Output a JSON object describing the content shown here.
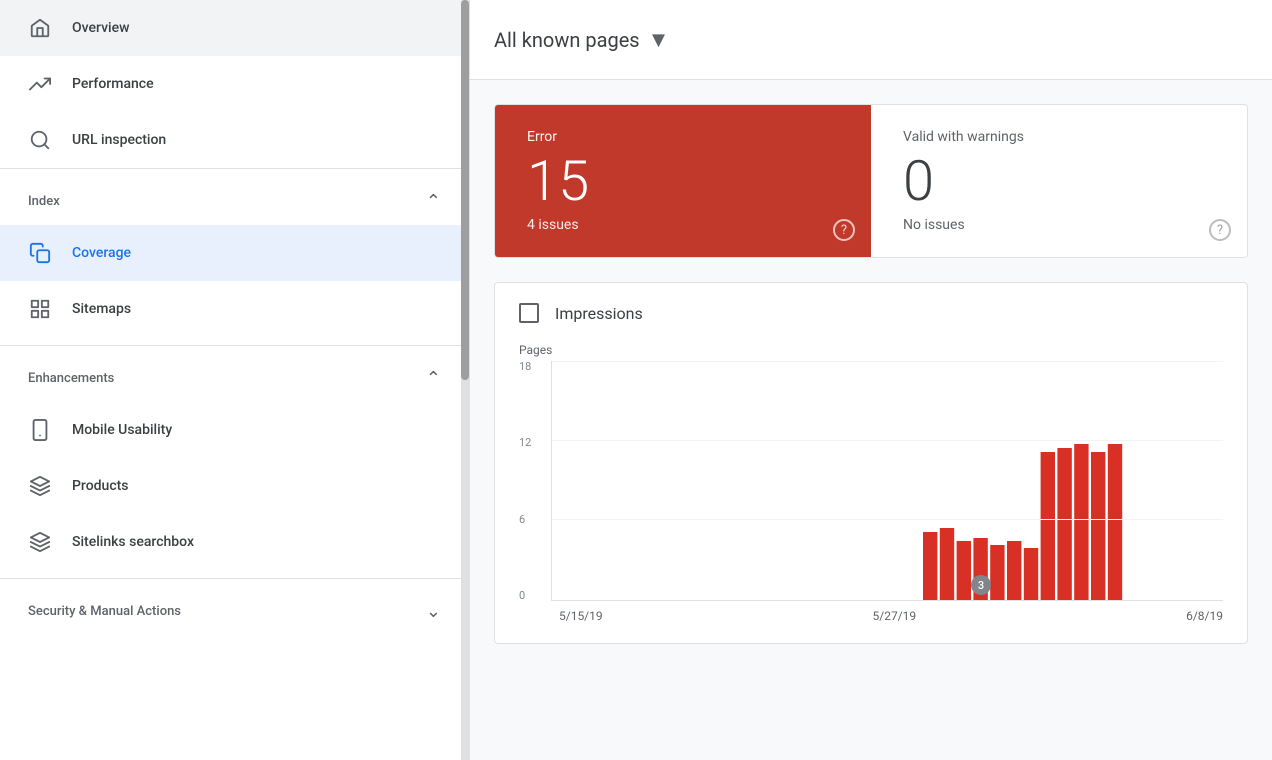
{
  "sidebar": {
    "items_top": [
      {
        "id": "overview",
        "label": "Overview",
        "icon": "home"
      },
      {
        "id": "performance",
        "label": "Performance",
        "icon": "trending-up"
      },
      {
        "id": "url-inspection",
        "label": "URL inspection",
        "icon": "search"
      }
    ],
    "sections": [
      {
        "id": "index",
        "label": "Index",
        "expanded": true,
        "items": [
          {
            "id": "coverage",
            "label": "Coverage",
            "icon": "copy",
            "active": true
          },
          {
            "id": "sitemaps",
            "label": "Sitemaps",
            "icon": "grid"
          }
        ]
      },
      {
        "id": "enhancements",
        "label": "Enhancements",
        "expanded": true,
        "items": [
          {
            "id": "mobile-usability",
            "label": "Mobile Usability",
            "icon": "mobile"
          },
          {
            "id": "products",
            "label": "Products",
            "icon": "layers"
          },
          {
            "id": "sitelinks-searchbox",
            "label": "Sitelinks searchbox",
            "icon": "layers2"
          }
        ]
      },
      {
        "id": "security",
        "label": "Security & Manual Actions",
        "expanded": false,
        "items": []
      }
    ]
  },
  "header": {
    "page_selector_label": "All known pages",
    "dropdown_aria": "Change page filter"
  },
  "error_card": {
    "label": "Error",
    "number": "15",
    "sub": "4 issues",
    "help": "?"
  },
  "valid_card": {
    "label": "Valid with warnings",
    "number": "0",
    "sub": "No issues",
    "help": "?"
  },
  "impressions": {
    "label": "Impressions",
    "y_axis_label": "Pages",
    "y_values": [
      "18",
      "12",
      "6",
      "0"
    ],
    "x_labels": [
      "5/15/19",
      "5/27/19",
      "6/8/19"
    ],
    "tooltip_value": "3",
    "bars": [
      0,
      0,
      0,
      0,
      0,
      0,
      0,
      0,
      0,
      0,
      0,
      0,
      0,
      0,
      0,
      0,
      0,
      0,
      0,
      0,
      0,
      0,
      5.2,
      5.5,
      4.5,
      4.7,
      4.2,
      4.5,
      4.0,
      11.2,
      11.5,
      11.8,
      11.2,
      11.8
    ]
  }
}
